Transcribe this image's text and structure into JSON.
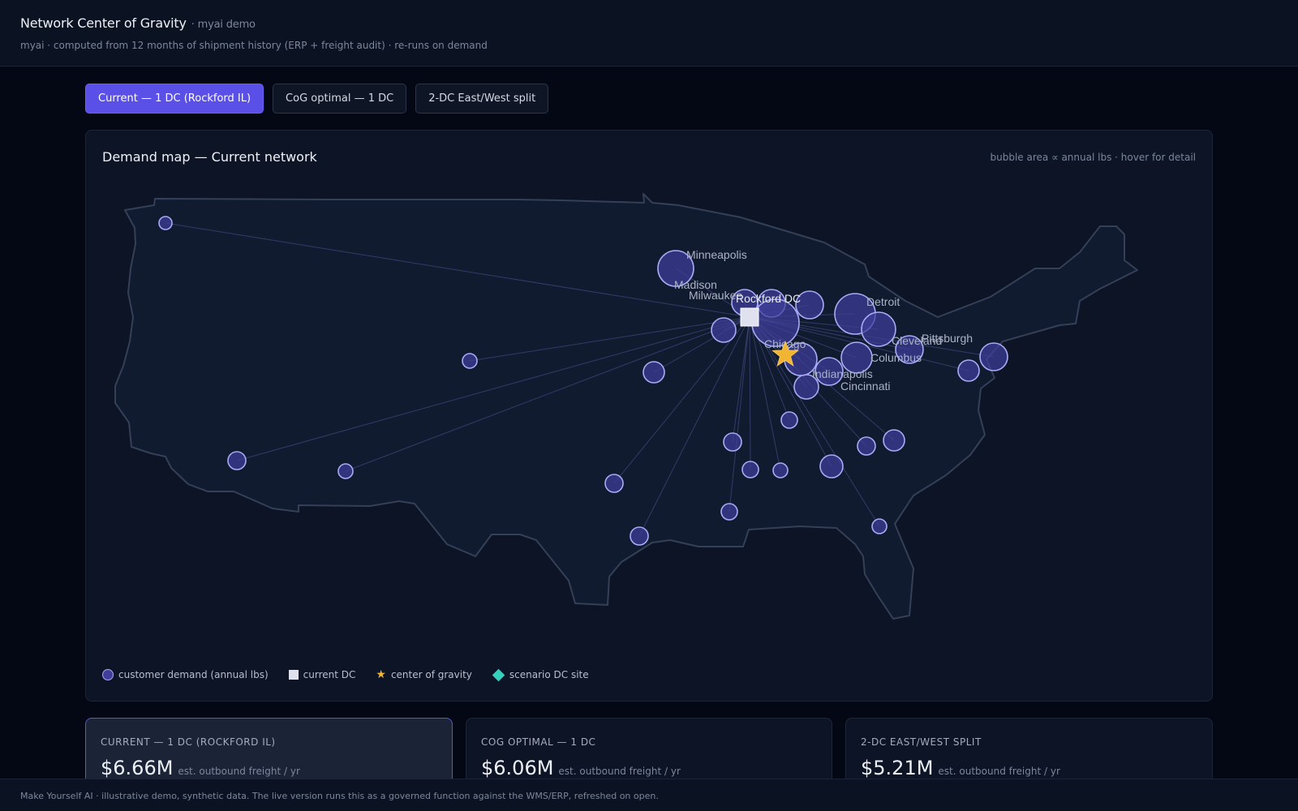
{
  "header": {
    "title": "Network Center of Gravity",
    "tag": "· myai demo",
    "subtitle": "myai · computed from 12 months of shipment history (ERP + freight audit) · re-runs on demand"
  },
  "tabs": [
    {
      "label": "Current — 1 DC (Rockford IL)",
      "active": true
    },
    {
      "label": "CoG optimal — 1 DC",
      "active": false
    },
    {
      "label": "2-DC East/West split",
      "active": false
    }
  ],
  "map": {
    "title": "Demand map — Current network",
    "hint": "bubble area ∝ annual lbs · hover for detail",
    "dc_label": "Rockford DC",
    "city_labels": [
      {
        "name": "Minneapolis"
      },
      {
        "name": "Madison"
      },
      {
        "name": "Milwaukee"
      },
      {
        "name": "Detroit"
      },
      {
        "name": "Chicago"
      },
      {
        "name": "Cleveland"
      },
      {
        "name": "Pittsburgh"
      },
      {
        "name": "Columbus"
      },
      {
        "name": "Indianapolis"
      },
      {
        "name": "Cincinnati"
      }
    ],
    "colors": {
      "bubble_fill": "#3f3f9a",
      "bubble_stroke": "#a9abf5",
      "dc": "#dfe2ee",
      "cog_star": "#f2b533",
      "scenario_site": "#34d1bf"
    }
  },
  "legend": {
    "demand": "customer demand (annual lbs)",
    "dc": "current DC",
    "cog": "center of gravity",
    "scenario": "scenario DC site"
  },
  "cards": [
    {
      "label": "CURRENT — 1 DC (ROCKFORD IL)",
      "value": "$6.66M",
      "unit": "est. outbound freight / yr",
      "active": true
    },
    {
      "label": "COG OPTIMAL — 1 DC",
      "value": "$6.06M",
      "unit": "est. outbound freight / yr",
      "active": false
    },
    {
      "label": "2-DC EAST/WEST SPLIT",
      "value": "$5.21M",
      "unit": "est. outbound freight / yr",
      "active": false
    }
  ],
  "footer": "Make Yourself AI · illustrative demo, synthetic data. The live version runs this as a governed function against the WMS/ERP, refreshed on open."
}
